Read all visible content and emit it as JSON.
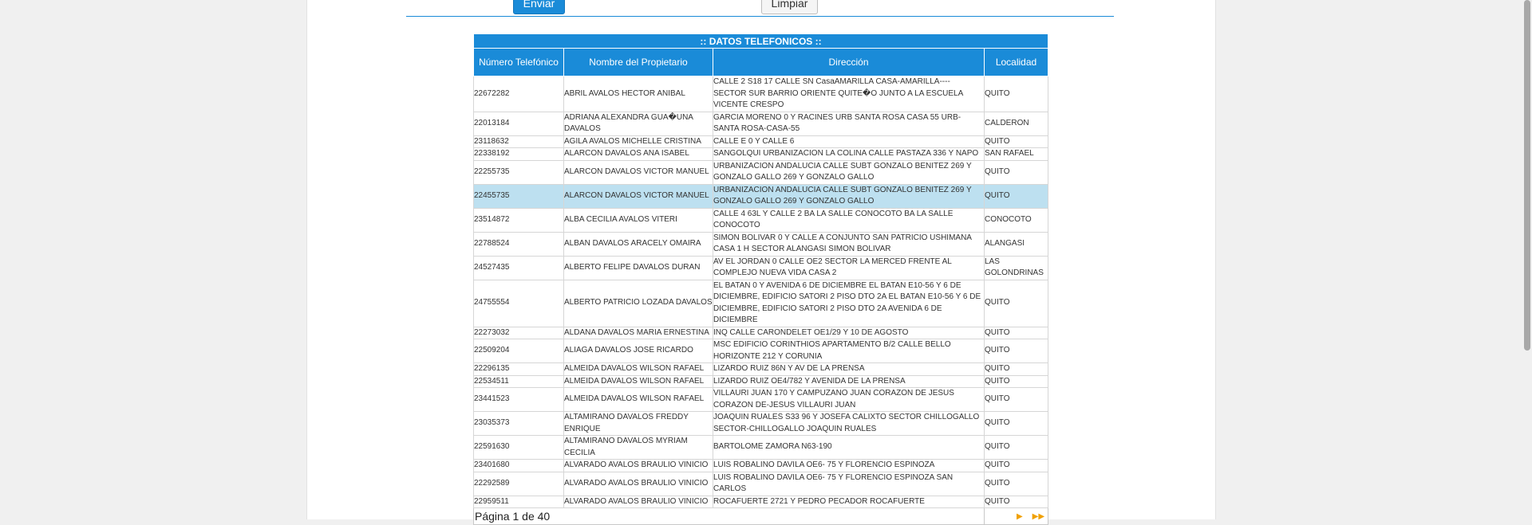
{
  "form": {
    "submit_label": "Enviar",
    "clear_label": "Limpiar"
  },
  "table": {
    "title": ":: DATOS TELEFONICOS ::",
    "headers": [
      "Número Telefónico",
      "Nombre del Propietario",
      "Dirección",
      "Localidad"
    ],
    "selected_row_index": 5,
    "rows": [
      [
        "22672282",
        "ABRIL AVALOS HECTOR ANIBAL",
        "CALLE 2 S18 17 CALLE SN CasaAMARILLA CASA-AMARILLA---- SECTOR SUR BARRIO ORIENTE QUITE�O JUNTO A LA ESCUELA VICENTE CRESPO",
        "QUITO"
      ],
      [
        "22013184",
        "ADRIANA ALEXANDRA GUA�UNA DAVALOS",
        "GARCIA MORENO 0 Y RACINES URB SANTA ROSA CASA 55 URB-SANTA ROSA-CASA-55",
        "CALDERON"
      ],
      [
        "23118632",
        "AGILA AVALOS MICHELLE CRISTINA",
        "CALLE E 0 Y CALLE 6",
        "QUITO"
      ],
      [
        "22338192",
        "ALARCON DAVALOS ANA ISABEL",
        "SANGOLQUI URBANIZACION LA COLINA CALLE PASTAZA 336 Y NAPO",
        "SAN RAFAEL"
      ],
      [
        "22255735",
        "ALARCON DAVALOS VICTOR MANUEL",
        "URBANIZACION ANDALUCIA CALLE SUBT GONZALO BENITEZ 269 Y GONZALO GALLO 269 Y GONZALO GALLO",
        "QUITO"
      ],
      [
        "22455735",
        "ALARCON DAVALOS VICTOR MANUEL",
        "URBANIZACION ANDALUCIA CALLE SUBT GONZALO BENITEZ 269 Y GONZALO GALLO 269 Y GONZALO GALLO",
        "QUITO"
      ],
      [
        "23514872",
        "ALBA CECILIA AVALOS VITERI",
        "CALLE 4 63L Y CALLE 2 BA LA SALLE CONOCOTO BA LA SALLE CONOCOTO",
        "CONOCOTO"
      ],
      [
        "22788524",
        "ALBAN DAVALOS ARACELY OMAIRA",
        "SIMON BOLIVAR 0 Y CALLE A CONJUNTO SAN PATRICIO USHIMANA CASA 1 H SECTOR ALANGASI SIMON BOLIVAR",
        "ALANGASI"
      ],
      [
        "24527435",
        "ALBERTO FELIPE DAVALOS DURAN",
        "AV EL JORDAN 0 CALLE OE2 SECTOR LA MERCED FRENTE AL COMPLEJO NUEVA VIDA CASA 2",
        "LAS GOLONDRINAS"
      ],
      [
        "24755554",
        "ALBERTO PATRICIO LOZADA DAVALOS",
        "EL BATAN 0 Y AVENIDA 6 DE DICIEMBRE EL BATAN E10-56 Y 6 DE DICIEMBRE, EDIFICIO SATORI 2 PISO DTO 2A EL BATAN E10-56 Y 6 DE DICIEMBRE, EDIFICIO SATORI 2 PISO DTO 2A AVENIDA 6 DE DICIEMBRE",
        "QUITO"
      ],
      [
        "22273032",
        "ALDANA DAVALOS MARIA ERNESTINA",
        "INQ CALLE CARONDELET OE1/29 Y 10 DE AGOSTO",
        "QUITO"
      ],
      [
        "22509204",
        "ALIAGA DAVALOS JOSE RICARDO",
        "MSC EDIFICIO CORINTHIOS APARTAMENTO B/2 CALLE BELLO HORIZONTE 212 Y CORUNIA",
        "QUITO"
      ],
      [
        "22296135",
        "ALMEIDA DAVALOS WILSON RAFAEL",
        "LIZARDO RUIZ 86N Y AV DE LA PRENSA",
        "QUITO"
      ],
      [
        "22534511",
        "ALMEIDA DAVALOS WILSON RAFAEL",
        "LIZARDO RUIZ OE4/782 Y AVENIDA DE LA PRENSA",
        "QUITO"
      ],
      [
        "23441523",
        "ALMEIDA DAVALOS WILSON RAFAEL",
        "VILLAURI JUAN 170 Y CAMPUZANO JUAN CORAZON DE JESUS CORAZON DE-JESUS VILLAURI JUAN",
        "QUITO"
      ],
      [
        "23035373",
        "ALTAMIRANO DAVALOS FREDDY ENRIQUE",
        "JOAQUIN RUALES S33 96 Y JOSEFA CALIXTO SECTOR CHILLOGALLO SECTOR-CHILLOGALLO JOAQUIN RUALES",
        "QUITO"
      ],
      [
        "22591630",
        "ALTAMIRANO DAVALOS MYRIAM CECILIA",
        "BARTOLOME ZAMORA N63-190",
        "QUITO"
      ],
      [
        "23401680",
        "ALVARADO AVALOS BRAULIO VINICIO",
        "LUIS ROBALINO DAVILA OE6- 75 Y FLORENCIO ESPINOZA",
        "QUITO"
      ],
      [
        "22292589",
        "ALVARADO AVALOS BRAULIO VINICIO",
        "LUIS ROBALINO DAVILA OE6- 75 Y FLORENCIO ESPINOZA SAN CARLOS",
        "QUITO"
      ],
      [
        "22959511",
        "ALVARADO AVALOS BRAULIO VINICIO",
        "ROCAFUERTE 2721 Y PEDRO PECADOR ROCAFUERTE",
        "QUITO"
      ]
    ]
  },
  "pager": {
    "page_text": "Página 1 de 40",
    "next_icon": "next-arrow-icon",
    "last_icon": "last-arrow-icon",
    "next_glyph": "▶",
    "last_glyph": "▶▶"
  },
  "colors": {
    "accent": "#1a8bd8",
    "selected_row": "#bde0f0",
    "pager_arrow": "#f0a000"
  }
}
